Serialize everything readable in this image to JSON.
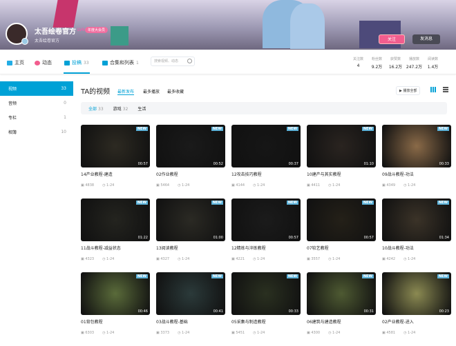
{
  "header": {
    "username": "太吾绘卷官方",
    "level": "LV6",
    "vip_badge": "年度大会员",
    "sign": "太吾绘卷官方",
    "follow_label": "关注",
    "message_label": "发消息"
  },
  "nav": {
    "items": [
      {
        "label": "主页",
        "count": "",
        "color": "#23ade5"
      },
      {
        "label": "动态",
        "count": "",
        "color": "#f25d8e"
      },
      {
        "label": "投稿",
        "count": "33",
        "color": "#00a1d6"
      },
      {
        "label": "合集和列表",
        "count": "1",
        "color": "#00a1d6"
      }
    ],
    "search_placeholder": "搜索视频、动态"
  },
  "stats": [
    {
      "label": "关注数",
      "value": "4"
    },
    {
      "label": "粉丝数",
      "value": "9.2万"
    },
    {
      "label": "获赞数",
      "value": "16.2万"
    },
    {
      "label": "播放数",
      "value": "247.2万"
    },
    {
      "label": "阅读数",
      "value": "1.4万"
    }
  ],
  "sidebar": [
    {
      "label": "视频",
      "count": "33"
    },
    {
      "label": "音频",
      "count": "0"
    },
    {
      "label": "专栏",
      "count": "1"
    },
    {
      "label": "相簿",
      "count": "10"
    }
  ],
  "main": {
    "title": "TA的视频",
    "tabs": [
      "最新发布",
      "最多播放",
      "最多收藏"
    ],
    "play_all": "播放全部",
    "filters": [
      {
        "label": "全部",
        "count": "33"
      },
      {
        "label": "游戏",
        "count": "32"
      },
      {
        "label": "生活",
        "count": ""
      }
    ],
    "new_badge": "NEW",
    "videos": [
      {
        "title": "14产业教程-建造",
        "duration": "00:57",
        "plays": "4838",
        "date": "1-24"
      },
      {
        "title": "02作业教程",
        "duration": "00:52",
        "plays": "5464",
        "date": "1-24"
      },
      {
        "title": "12攻击技巧教程",
        "duration": "00:37",
        "plays": "4144",
        "date": "1-24"
      },
      {
        "title": "10建产与其实教程",
        "duration": "01:10",
        "plays": "4411",
        "date": "1-24"
      },
      {
        "title": "09战斗教程-功法",
        "duration": "00:33",
        "plays": "4349",
        "date": "1-24"
      },
      {
        "title": "11战斗教程-减益状态",
        "duration": "01:22",
        "plays": "4323",
        "date": "1-24"
      },
      {
        "title": "13阅读教程",
        "duration": "01:00",
        "plays": "4327",
        "date": "1-24"
      },
      {
        "title": "12精练与淬炼教程",
        "duration": "00:57",
        "plays": "4221",
        "date": "1-24"
      },
      {
        "title": "07较艺教程",
        "duration": "00:57",
        "plays": "3557",
        "date": "1-24"
      },
      {
        "title": "10战斗教程-功法",
        "duration": "01:34",
        "plays": "4242",
        "date": "1-24"
      },
      {
        "title": "01背包教程",
        "duration": "00:46",
        "plays": "6303",
        "date": "1-24"
      },
      {
        "title": "03战斗教程-基础",
        "duration": "00:41",
        "plays": "3373",
        "date": "1-24"
      },
      {
        "title": "05采集与制造教程",
        "duration": "00:33",
        "plays": "5451",
        "date": "1-24"
      },
      {
        "title": "06建筑与建造教程",
        "duration": "00:31",
        "plays": "4300",
        "date": "1-24"
      },
      {
        "title": "02产业教程-进入",
        "duration": "00:23",
        "plays": "4581",
        "date": "1-24"
      }
    ]
  }
}
